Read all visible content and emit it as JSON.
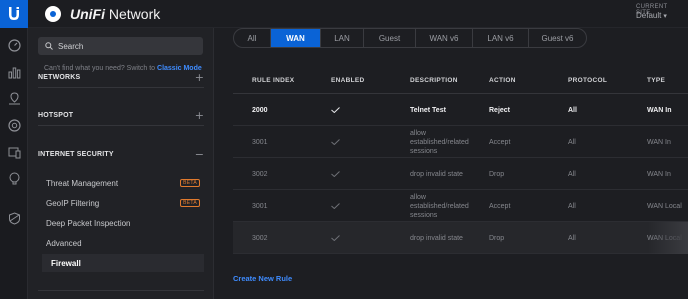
{
  "topbar": {
    "brand_prefix": "UniFi",
    "brand_suffix": " Network",
    "site_label": "CURRENT SITE",
    "site_value": "Default"
  },
  "rail": {
    "icons": [
      "dashboard-icon",
      "statistics-icon",
      "map-icon",
      "devices-icon",
      "clients-icon",
      "insights-icon",
      "settings-icon"
    ]
  },
  "sidebar": {
    "search_placeholder": "Search",
    "hint_text": "Can't find what you need? Switch to ",
    "hint_link": "Classic Mode",
    "sections": [
      {
        "label": "NETWORKS",
        "toggle": "+"
      },
      {
        "label": "HOTSPOT",
        "toggle": "+"
      },
      {
        "label": "INTERNET SECURITY",
        "toggle": "−"
      }
    ],
    "items": [
      {
        "label": "Threat Management",
        "badge": "BETA"
      },
      {
        "label": "GeoIP Filtering",
        "badge": "BETA"
      },
      {
        "label": "Deep Packet Inspection",
        "badge": ""
      },
      {
        "label": "Advanced",
        "badge": ""
      },
      {
        "label": "Firewall",
        "badge": ""
      }
    ]
  },
  "tabs": [
    {
      "label": "All",
      "active": false
    },
    {
      "label": "WAN",
      "active": true
    },
    {
      "label": "LAN",
      "active": false
    },
    {
      "label": "Guest",
      "active": false
    },
    {
      "label": "WAN v6",
      "active": false
    },
    {
      "label": "LAN v6",
      "active": false
    },
    {
      "label": "Guest v6",
      "active": false
    }
  ],
  "table": {
    "headers": [
      "RULE INDEX",
      "ENABLED",
      "DESCRIPTION",
      "ACTION",
      "PROTOCOL",
      "TYPE"
    ],
    "rows": [
      {
        "index": "2000",
        "enabled": true,
        "description": "Telnet Test",
        "action": "Reject",
        "protocol": "All",
        "type": "WAN In"
      },
      {
        "index": "3001",
        "enabled": true,
        "description": "allow established/related sessions",
        "action": "Accept",
        "protocol": "All",
        "type": "WAN In"
      },
      {
        "index": "3002",
        "enabled": true,
        "description": "drop invalid state",
        "action": "Drop",
        "protocol": "All",
        "type": "WAN In"
      },
      {
        "index": "3001",
        "enabled": true,
        "description": "allow established/related sessions",
        "action": "Accept",
        "protocol": "All",
        "type": "WAN Local"
      },
      {
        "index": "3002",
        "enabled": true,
        "description": "drop invalid state",
        "action": "Drop",
        "protocol": "All",
        "type": "WAN Local"
      }
    ]
  },
  "create_rule_label": "Create New Rule",
  "colors": {
    "accent": "#0a63d6",
    "link": "#3f8cff",
    "beta": "#e07a2e"
  }
}
